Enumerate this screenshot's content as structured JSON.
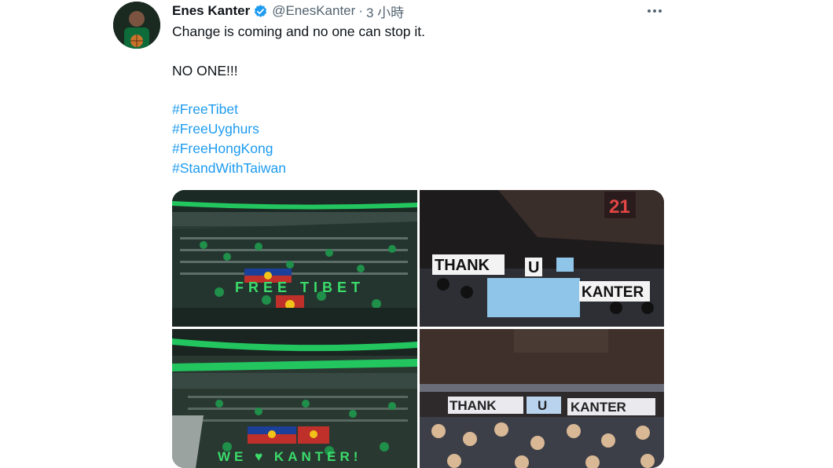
{
  "tweet": {
    "author_name": "Enes Kanter",
    "handle": "@EnesKanter",
    "separator": "·",
    "time": "3 小時",
    "lines": {
      "line1": "Change is coming and no one can stop it.",
      "line2": "NO ONE!!!"
    },
    "hashtags": [
      "#FreeTibet",
      "#FreeUyghurs",
      "#FreeHongKong",
      "#StandWithTaiwan"
    ],
    "more_icon": "more-horizontal-icon",
    "verified_icon": "verified-badge-icon"
  },
  "media": {
    "photos": [
      {
        "alt": "Arena crowd holding Tibetan flags",
        "signs": "FREE TIBET"
      },
      {
        "alt": "Fans with signs in arena suite",
        "signs": [
          "THANK",
          "U",
          "KANTER"
        ],
        "scoreboard": "21"
      },
      {
        "alt": "Arena crowd with Tibetan flags",
        "signs": "WE ♥ KANTER!"
      },
      {
        "alt": "Crowd with signs in stands",
        "signs": [
          "THANK",
          "U",
          "KANTER"
        ]
      }
    ]
  },
  "colors": {
    "link": "#1d9bf0",
    "secondary_text": "#536471",
    "verified": "#1d9bf0",
    "arena_green": "#22c55e"
  }
}
